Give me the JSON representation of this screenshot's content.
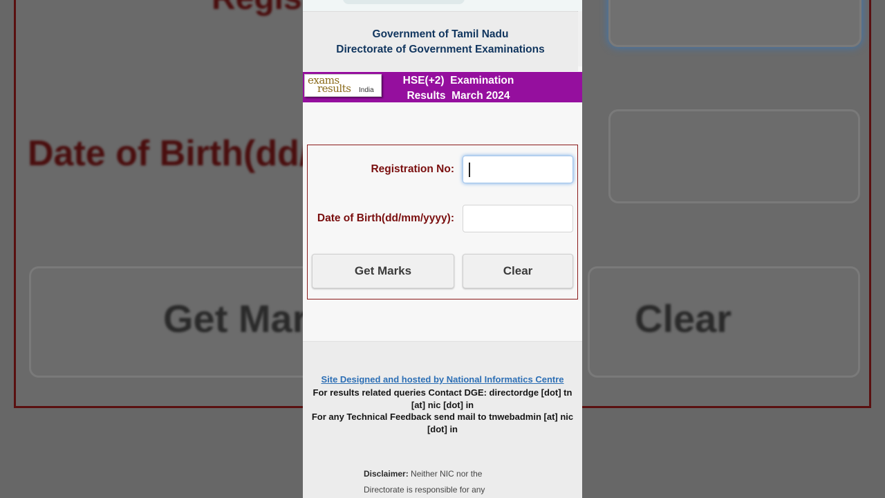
{
  "background": {
    "regis_fragment": "Regis",
    "dob_fragment": "Date of Birth(dd/",
    "get_fragment": "Get Mar",
    "clear_fragment": "Clear"
  },
  "header": {
    "line1": "Government of Tamil Nadu",
    "line2": "Directorate of Government Examinations"
  },
  "banner": {
    "logo_word1": "exams",
    "logo_word2": "results",
    "logo_word3": "India",
    "title": "HSE(+2)  Examination\nResults  March 2024"
  },
  "form": {
    "registration_label": "Registration No:",
    "registration_value": "",
    "dob_label": "Date of Birth(dd/mm/yyyy):",
    "dob_value": "",
    "get_marks_label": "Get Marks",
    "clear_label": "Clear"
  },
  "footer": {
    "link_text": "Site Designed and hosted by National Informatics Centre",
    "contact_text": "For results related queries Contact DGE:  directordge [dot] tn [at] nic [dot] in",
    "feedback_text": "For any Technical Feedback send mail to tnwebadmin [at] nic [dot] in",
    "disclaimer_label": "Disclaimer:",
    "disclaimer_text": " Neither NIC nor the Directorate is responsible for any"
  },
  "colors": {
    "banner": "#950f9e",
    "header_text": "#10355e",
    "label_text": "#7a0f0f",
    "link": "#2d6fb5"
  }
}
